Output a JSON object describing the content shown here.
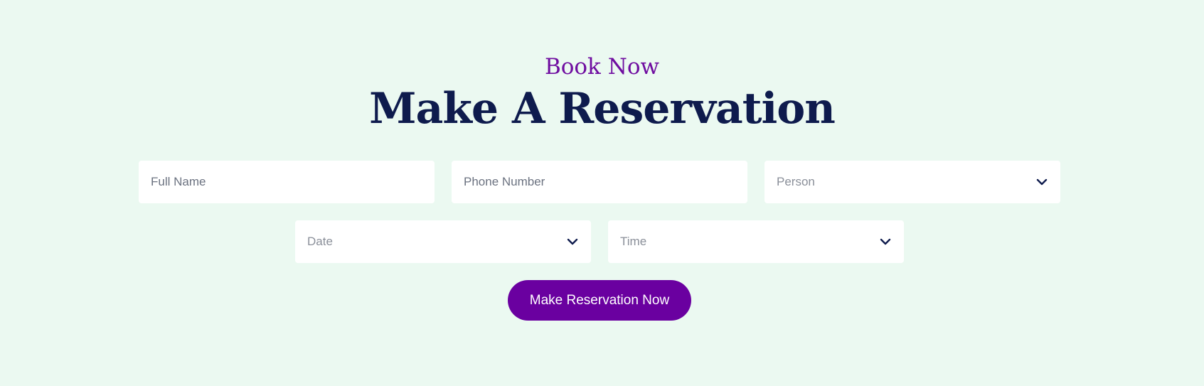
{
  "header": {
    "eyebrow": "Book Now",
    "title": "Make A Reservation"
  },
  "form": {
    "full_name": {
      "placeholder": "Full Name",
      "value": ""
    },
    "phone": {
      "placeholder": "Phone Number",
      "value": ""
    },
    "person": {
      "selected": "Person",
      "icon": "chevron-down-icon"
    },
    "date": {
      "selected": "Date",
      "icon": "chevron-down-icon"
    },
    "time": {
      "selected": "Time",
      "icon": "chevron-down-icon"
    },
    "submit_label": "Make Reservation Now"
  },
  "colors": {
    "background": "#ebf9f1",
    "accent": "#6a00a0",
    "heading": "#0e1b4d"
  }
}
